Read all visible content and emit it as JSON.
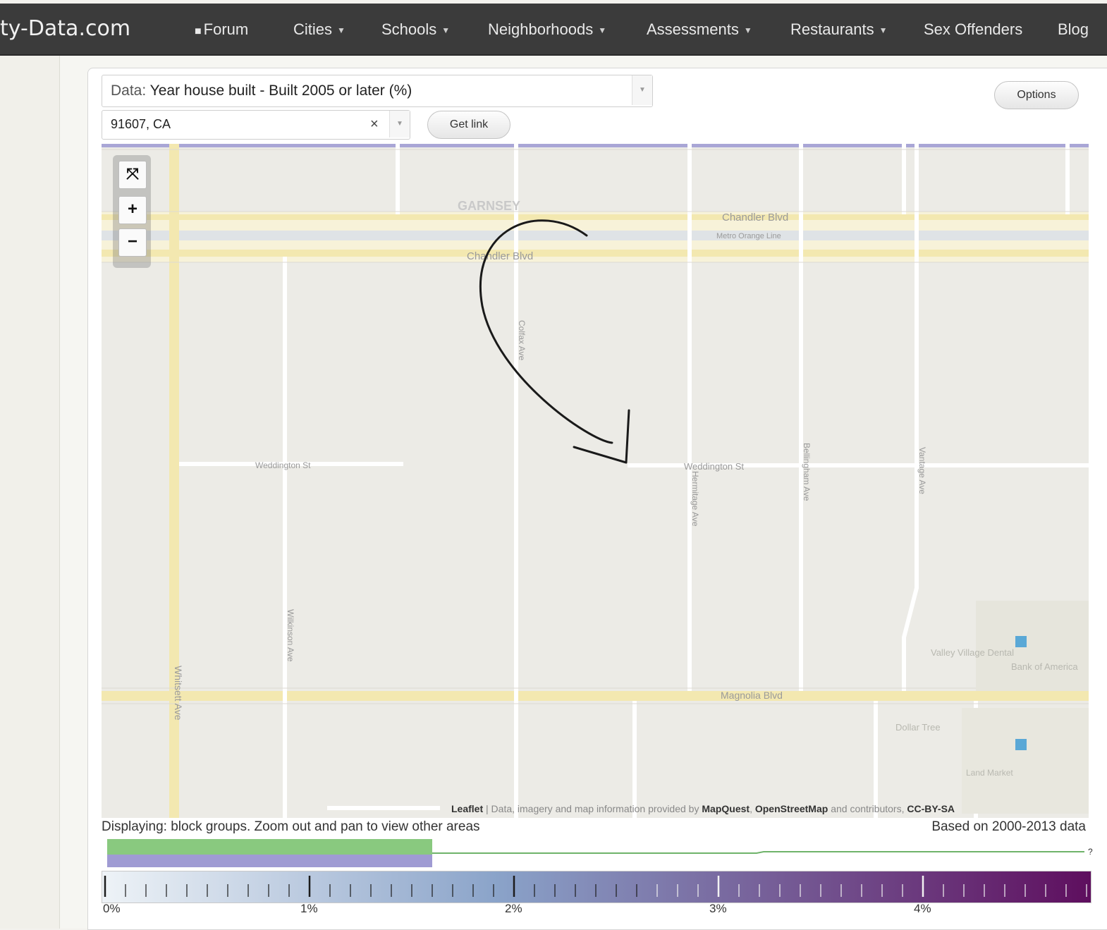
{
  "brand": "ty-Data.com",
  "nav": {
    "forum": "Forum",
    "cities": "Cities",
    "schools": "Schools",
    "neighborhoods": "Neighborhoods",
    "assessments": "Assessments",
    "restaurants": "Restaurants",
    "sex_offenders": "Sex Offenders",
    "blog": "Blog"
  },
  "controls": {
    "data_prefix": "Data:",
    "data_value": "Year house built - Built 2005 or later (%)",
    "location_value": "91607, CA",
    "clear_symbol": "×",
    "get_link": "Get link",
    "options": "Options"
  },
  "map": {
    "zoom_reset_symbol": "⤧",
    "zoom_in_symbol": "+",
    "zoom_out_symbol": "−",
    "labels": {
      "garnsey": "GARNSEY",
      "chandler_blvd_top": "Chandler Blvd",
      "metro_orange_line": "Metro Orange Line",
      "chandler_blvd": "Chandler Blvd",
      "weddington_st_left": "Weddington St",
      "weddington_st_right": "Weddington St",
      "magnolia_blvd": "Magnolia Blvd",
      "whitsett_ave": "Whitsett Ave",
      "wilkinson_ave": "Wilkinson Ave",
      "colfax_ave": "Colfax Ave",
      "hermitage_ave": "Hermitage Ave",
      "bellingham_ave": "Bellingham Ave",
      "vantage_ave": "Vantage Ave",
      "valley_village_dental": "Valley Village Dental",
      "bank_of_america": "Bank of America",
      "dollar_tree": "Dollar Tree",
      "land_market": "Land Market"
    }
  },
  "attribution": {
    "leaflet": "Leaflet",
    "text": " | Data, imagery and map information provided by ",
    "mapquest": "MapQuest",
    "osm": "OpenStreetMap",
    "and_contrib": " and contributors, ",
    "license": "CC-BY-SA"
  },
  "display_note": "Displaying: block groups. Zoom out and pan to view other areas",
  "based_on": "Based on 2000-2013 data",
  "legend": {
    "labels": [
      "0%",
      "1%",
      "2%",
      "3%",
      "4%"
    ],
    "colors": {
      "low": "#eef3f7",
      "mid": "#8aa3c9",
      "high": "#5e0e5e"
    },
    "histogram": {
      "green_fraction": 0.33,
      "purple_fraction": 0.33
    }
  }
}
